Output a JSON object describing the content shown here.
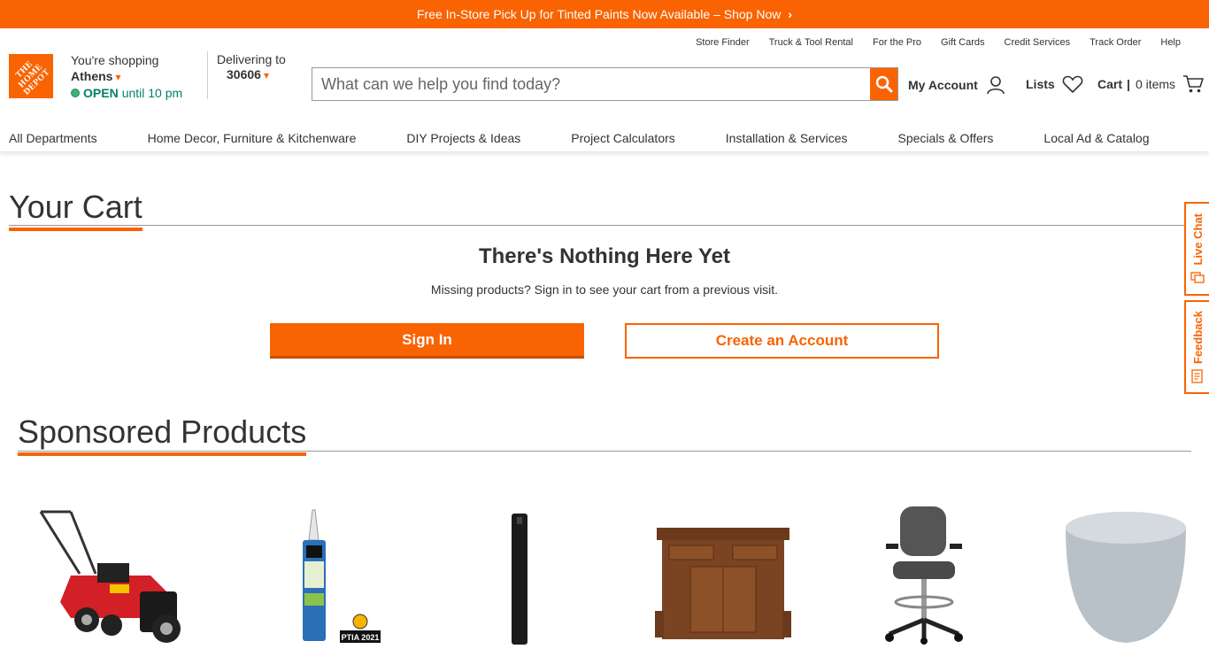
{
  "promo": {
    "text": "Free In-Store Pick Up for Tinted Paints Now Available – Shop Now"
  },
  "utility_links": [
    "Store Finder",
    "Truck & Tool Rental",
    "For the Pro",
    "Gift Cards",
    "Credit Services",
    "Track Order",
    "Help"
  ],
  "logo": {
    "text": "THE HOME DEPOT"
  },
  "store": {
    "shopping_label": "You're shopping",
    "city": "Athens",
    "open_label": "OPEN",
    "hours": "until 10 pm"
  },
  "delivery": {
    "label": "Delivering to",
    "zip": "30606"
  },
  "search": {
    "placeholder": "What can we help you find today?"
  },
  "account": {
    "label": "My Account"
  },
  "lists": {
    "label": "Lists"
  },
  "cart_header": {
    "label": "Cart",
    "separator": "|",
    "count": "0 items"
  },
  "nav": [
    "All Departments",
    "Home Decor, Furniture & Kitchenware",
    "DIY Projects & Ideas",
    "Project Calculators",
    "Installation & Services",
    "Specials & Offers",
    "Local Ad & Catalog"
  ],
  "cart": {
    "title": "Your Cart",
    "empty_heading": "There's Nothing Here Yet",
    "empty_sub": "Missing products? Sign in to see your cart from a previous visit.",
    "signin_button": "Sign In",
    "create_button": "Create an Account"
  },
  "side_tabs": {
    "live_chat": "Live Chat",
    "feedback": "Feedback"
  },
  "sponsored": {
    "title": "Sponsored Products",
    "products": [
      {
        "icon": "lawn-mower-icon"
      },
      {
        "icon": "caulk-tube-icon",
        "badge": "PTIA 2021"
      },
      {
        "icon": "tower-fan-icon"
      },
      {
        "icon": "kitchen-island-icon"
      },
      {
        "icon": "office-chair-icon"
      },
      {
        "icon": "pouf-ottoman-icon"
      }
    ]
  },
  "colors": {
    "brand": "#f96302",
    "open": "#00806e"
  }
}
